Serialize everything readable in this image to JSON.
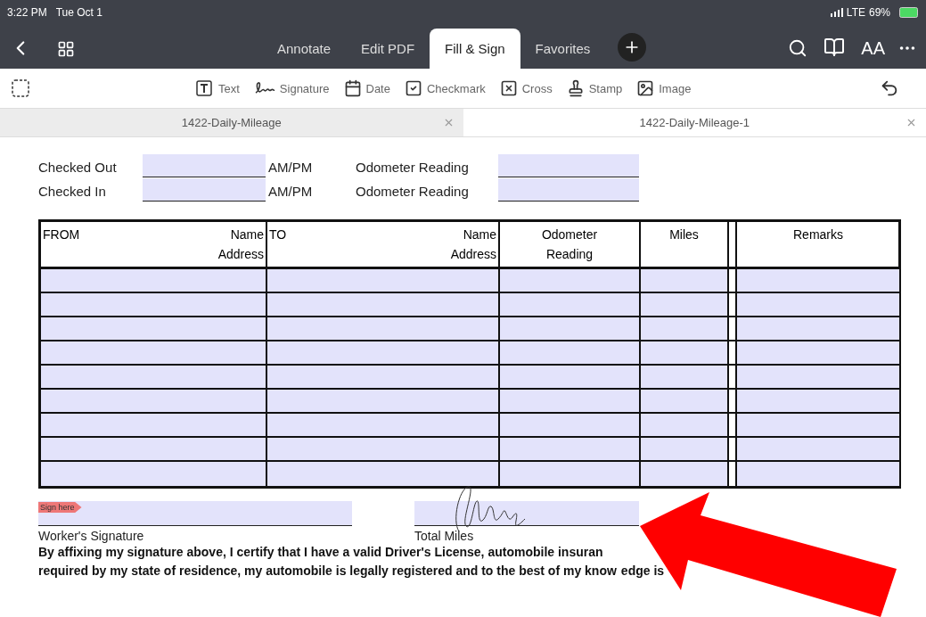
{
  "status_bar": {
    "time": "3:22 PM",
    "date": "Tue Oct 1",
    "network": "LTE",
    "battery": "69%"
  },
  "nav": {
    "tabs": [
      {
        "label": "Annotate",
        "selected": false
      },
      {
        "label": "Edit PDF",
        "selected": false
      },
      {
        "label": "Fill & Sign",
        "selected": true
      },
      {
        "label": "Favorites",
        "selected": false
      }
    ],
    "size_label": "AA"
  },
  "tools": [
    {
      "kind": "text",
      "label": "Text"
    },
    {
      "kind": "signature",
      "label": "Signature"
    },
    {
      "kind": "date",
      "label": "Date"
    },
    {
      "kind": "checkmark",
      "label": "Checkmark"
    },
    {
      "kind": "cross",
      "label": "Cross"
    },
    {
      "kind": "stamp",
      "label": "Stamp"
    },
    {
      "kind": "image",
      "label": "Image"
    }
  ],
  "documents": [
    {
      "title": "1422-Daily-Mileage",
      "selected": false
    },
    {
      "title": "1422-Daily-Mileage-1",
      "selected": true
    }
  ],
  "form": {
    "time_rows": [
      {
        "label": "Checked Out",
        "unit": "AM/PM",
        "reading_label": "Odometer Reading"
      },
      {
        "label": "Checked In",
        "unit": "AM/PM",
        "reading_label": "Odometer Reading"
      }
    ],
    "table": {
      "columns": [
        {
          "title": "FROM",
          "right": [
            "Name",
            "Address"
          ]
        },
        {
          "title": "TO",
          "right": [
            "Name",
            "Address"
          ]
        },
        {
          "center": [
            "Odometer",
            "Reading"
          ]
        },
        {
          "center": [
            "Miles"
          ]
        },
        {
          "center": [
            "Remarks"
          ]
        }
      ]
    },
    "sign_tag": "Sign here",
    "worker_label": "Worker's Signature",
    "total_label": "Total Miles",
    "statement": [
      "By affixing my signature above, I certify that I have a valid Driver's License, automobile insuran",
      "required by my state of residence, my automobile is legally registered and to the best of my know",
      "edge is"
    ]
  }
}
